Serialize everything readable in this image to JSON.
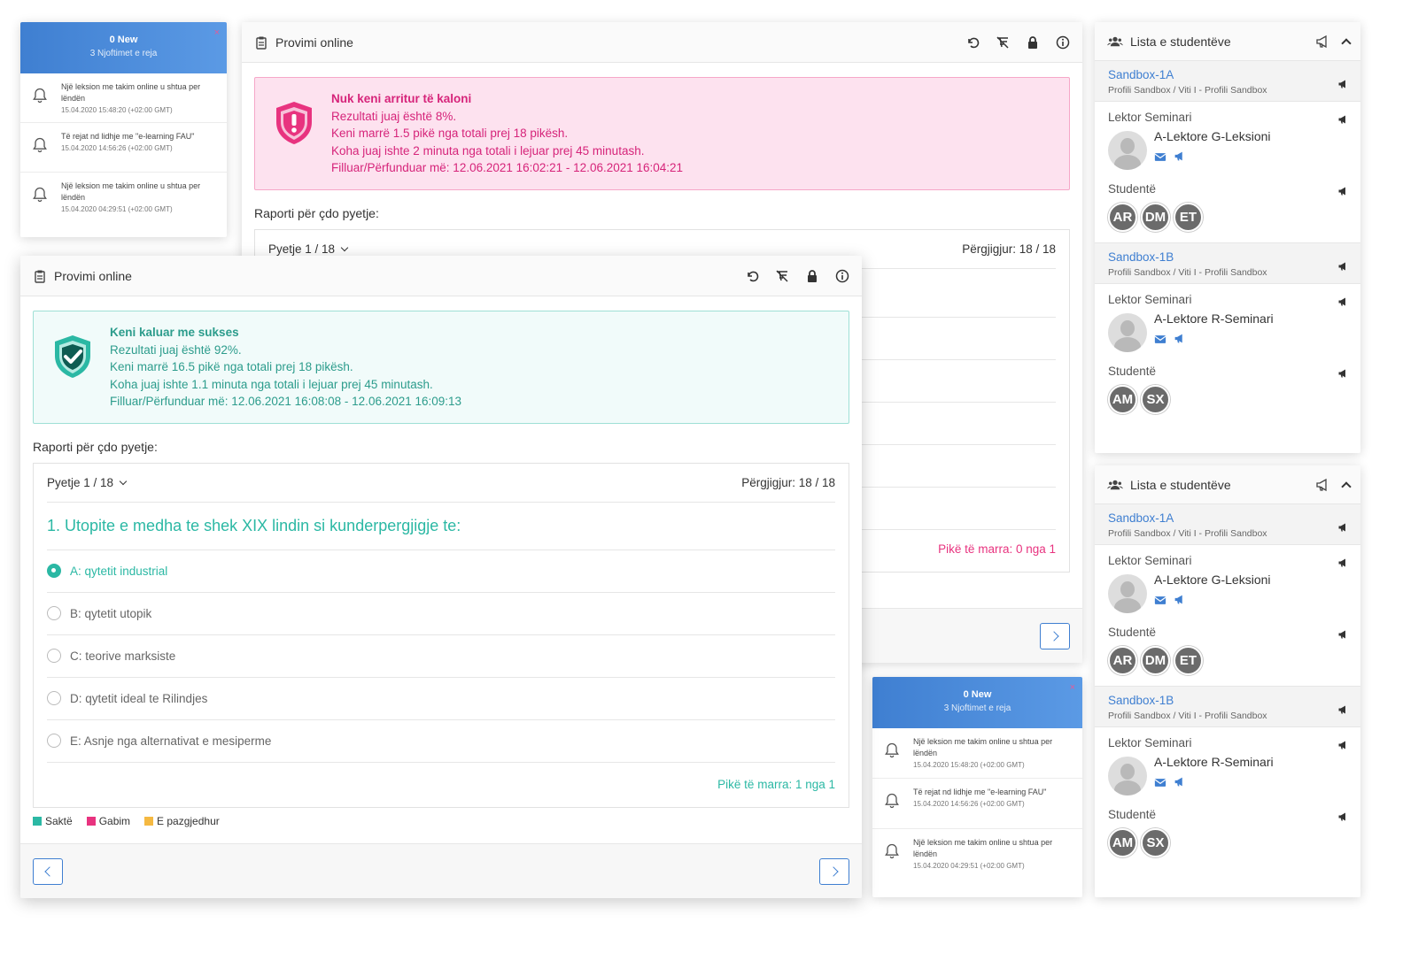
{
  "colors": {
    "accent": "#3f7fd1",
    "success": "#2bb8a4",
    "error": "#d6247a",
    "warning": "#f5b942"
  },
  "notifications": {
    "count_label": "0 New",
    "subtitle": "3 Njoftimet e reja",
    "close": "×",
    "items": [
      {
        "text": "Një leksion me takim online u shtua per lëndën",
        "time": "15.04.2020 15:48:20 (+02:00 GMT)"
      },
      {
        "text": "Të rejat nd lidhje me \"e-learning FAU\"",
        "time": "15.04.2020 14:56:26 (+02:00 GMT)"
      },
      {
        "text": "Një leksion me takim online u shtua per lëndën",
        "time": "15.04.2020 04:29:51 (+02:00 GMT)"
      }
    ]
  },
  "exam_fail": {
    "title": "Provimi online",
    "alert": [
      "Nuk keni arritur të kaloni",
      "Rezultati juaj është 8%.",
      "Keni marrë 1.5 pikë nga totali prej 18 pikësh.",
      "Koha juaj ishte 2 minuta nga totali i lejuar prej 45 minutash.",
      "Filluar/Përfunduar më: 12.06.2021 16:02:21 - 12.06.2021 16:04:21"
    ],
    "report_title": "Raporti për çdo pyetje:",
    "question_counter": "Pyetje 1 / 18",
    "answered": "Përgjigjur: 18 / 18",
    "points": "Pikë të marra: 0 nga 1"
  },
  "exam_pass": {
    "title": "Provimi online",
    "alert": [
      "Keni kaluar me sukses",
      "Rezultati juaj është 92%.",
      "Keni marrë 16.5 pikë nga totali prej 18 pikësh.",
      "Koha juaj ishte 1.1 minuta nga totali i lejuar prej 45 minutash.",
      "Filluar/Përfunduar më: 12.06.2021 16:08:08 - 12.06.2021 16:09:13"
    ],
    "report_title": "Raporti për çdo pyetje:",
    "question_counter": "Pyetje 1 / 18",
    "answered": "Përgjigjur: 18 / 18",
    "question": "1. Utopite e medha te shek XIX lindin si kunderpergjigje te:",
    "options": [
      {
        "label": "A: qytetit industrial",
        "selected": true
      },
      {
        "label": "B: qytetit utopik",
        "selected": false
      },
      {
        "label": "C: teorive marksiste",
        "selected": false
      },
      {
        "label": "D: qytetit ideal te Rilindjes",
        "selected": false
      },
      {
        "label": "E: Asnje nga alternativat e mesiperme",
        "selected": false
      }
    ],
    "points": "Pikë të marra: 1 nga 1",
    "legend": [
      "Saktë",
      "Gabim",
      "E pazgjedhur"
    ]
  },
  "students": {
    "title": "Lista e studentëve",
    "groups": [
      {
        "name": "Sandbox-1A",
        "sub": "Profili Sandbox / Viti I - Profili Sandbox",
        "lector_label": "Lektor Seminari",
        "lector_name": "A-Lektore G-Leksioni",
        "students_label": "Studentë",
        "initials": [
          "AR",
          "DM",
          "ET"
        ]
      },
      {
        "name": "Sandbox-1B",
        "sub": "Profili Sandbox / Viti I - Profili Sandbox",
        "lector_label": "Lektor Seminari",
        "lector_name": "A-Lektore R-Seminari",
        "students_label": "Studentë",
        "initials": [
          "AM",
          "SX"
        ]
      }
    ]
  }
}
